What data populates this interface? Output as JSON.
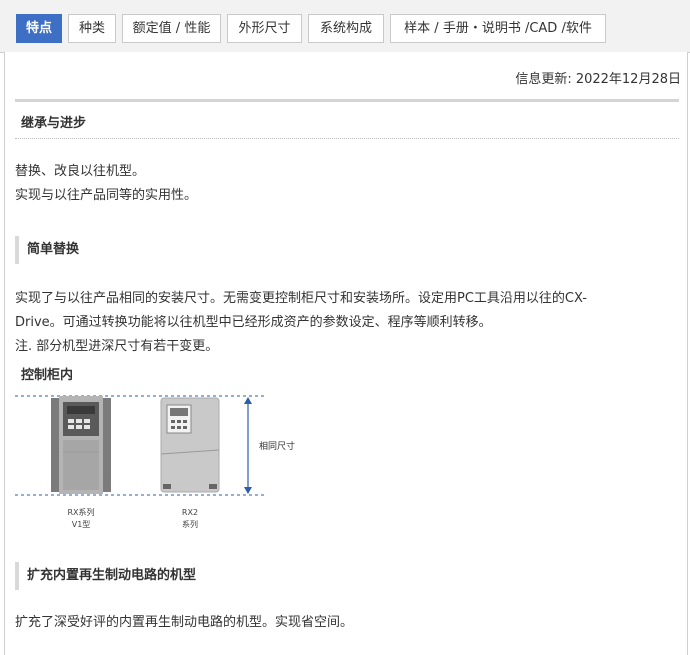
{
  "tabs": [
    {
      "label": "特点",
      "active": true
    },
    {
      "label": "种类",
      "active": false
    },
    {
      "label": "额定值 / 性能",
      "active": false
    },
    {
      "label": "外形尺寸",
      "active": false
    },
    {
      "label": "系统构成",
      "active": false
    },
    {
      "label": "样本 / 手册・说明书 /CAD /软件",
      "active": false
    }
  ],
  "info_updated": "信息更新: 2022年12月28日",
  "sections": {
    "main_heading": "继承与进步",
    "intro_lines": [
      "替换、改良以往机型。",
      "实现与以往产品同等的实用性。"
    ],
    "simple_replace": {
      "heading": "简单替换",
      "lines": [
        "实现了与以往产品相同的安装尺寸。无需变更控制柜尺寸和安装场所。设定用PC工具沿用以往的CX-",
        "Drive。可通过转换功能将以往机型中已经形成资产的参数设定、程序等顺利转移。",
        "注. 部分机型进深尺寸有若干变更。"
      ],
      "figure": {
        "title": "控制柜内",
        "dimension_label": "相同尺寸",
        "device_a_label_1": "RX系列",
        "device_a_label_2": "V1型",
        "device_b_label_1": "RX2",
        "device_b_label_2": "系列"
      }
    },
    "regen": {
      "heading": "扩充内置再生制动电路的机型",
      "text": "扩充了深受好评的内置再生制动电路的机型。实现省空间。"
    }
  },
  "colors": {
    "accent": "#3d6fc4",
    "dim_line": "#2b5fa6"
  }
}
